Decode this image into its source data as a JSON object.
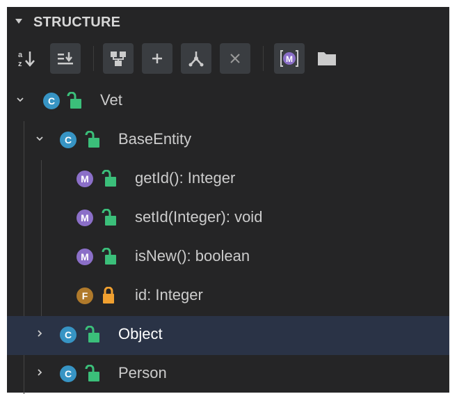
{
  "section": {
    "title": "STRUCTURE"
  },
  "toolbar": {
    "buttons": [
      {
        "name": "sort-alphabetically",
        "icon": "sort-az-icon",
        "label": "a z"
      },
      {
        "name": "sort-by-visibility",
        "icon": "sort-lines-icon"
      },
      {
        "name": "show-hierarchy",
        "icon": "hierarchy-icon"
      },
      {
        "name": "expand-all",
        "icon": "plus-icon",
        "label": "+"
      },
      {
        "name": "show-inherited",
        "icon": "inherit-icon"
      },
      {
        "name": "collapse-all",
        "icon": "close-icon",
        "label": "×"
      },
      {
        "name": "show-members",
        "icon": "members-icon",
        "label": "M"
      },
      {
        "name": "show-folder",
        "icon": "folder-icon"
      }
    ]
  },
  "tree": {
    "items": [
      {
        "kind": "C",
        "label": "Vet",
        "expanded": true,
        "visibility": "public",
        "level": 0
      },
      {
        "kind": "C",
        "label": "BaseEntity",
        "expanded": true,
        "visibility": "public",
        "level": 1
      },
      {
        "kind": "M",
        "label": "getId(): Integer",
        "visibility": "public",
        "level": 2
      },
      {
        "kind": "M",
        "label": "setId(Integer): void",
        "visibility": "public",
        "level": 2
      },
      {
        "kind": "M",
        "label": "isNew(): boolean",
        "visibility": "public",
        "level": 2
      },
      {
        "kind": "F",
        "label": "id: Integer",
        "visibility": "protected",
        "level": 2
      },
      {
        "kind": "C",
        "label": "Object",
        "expanded": false,
        "visibility": "public",
        "level": 1,
        "selected": true
      },
      {
        "kind": "C",
        "label": "Person",
        "expanded": false,
        "visibility": "public",
        "level": 1
      }
    ]
  },
  "colors": {
    "class_badge": "#3794c4",
    "method_badge": "#8b6fc8",
    "field_badge": "#b07a2b",
    "public_lock": "#3bbf7a",
    "protected_lock": "#f0a030",
    "selection": "#2a3346"
  }
}
